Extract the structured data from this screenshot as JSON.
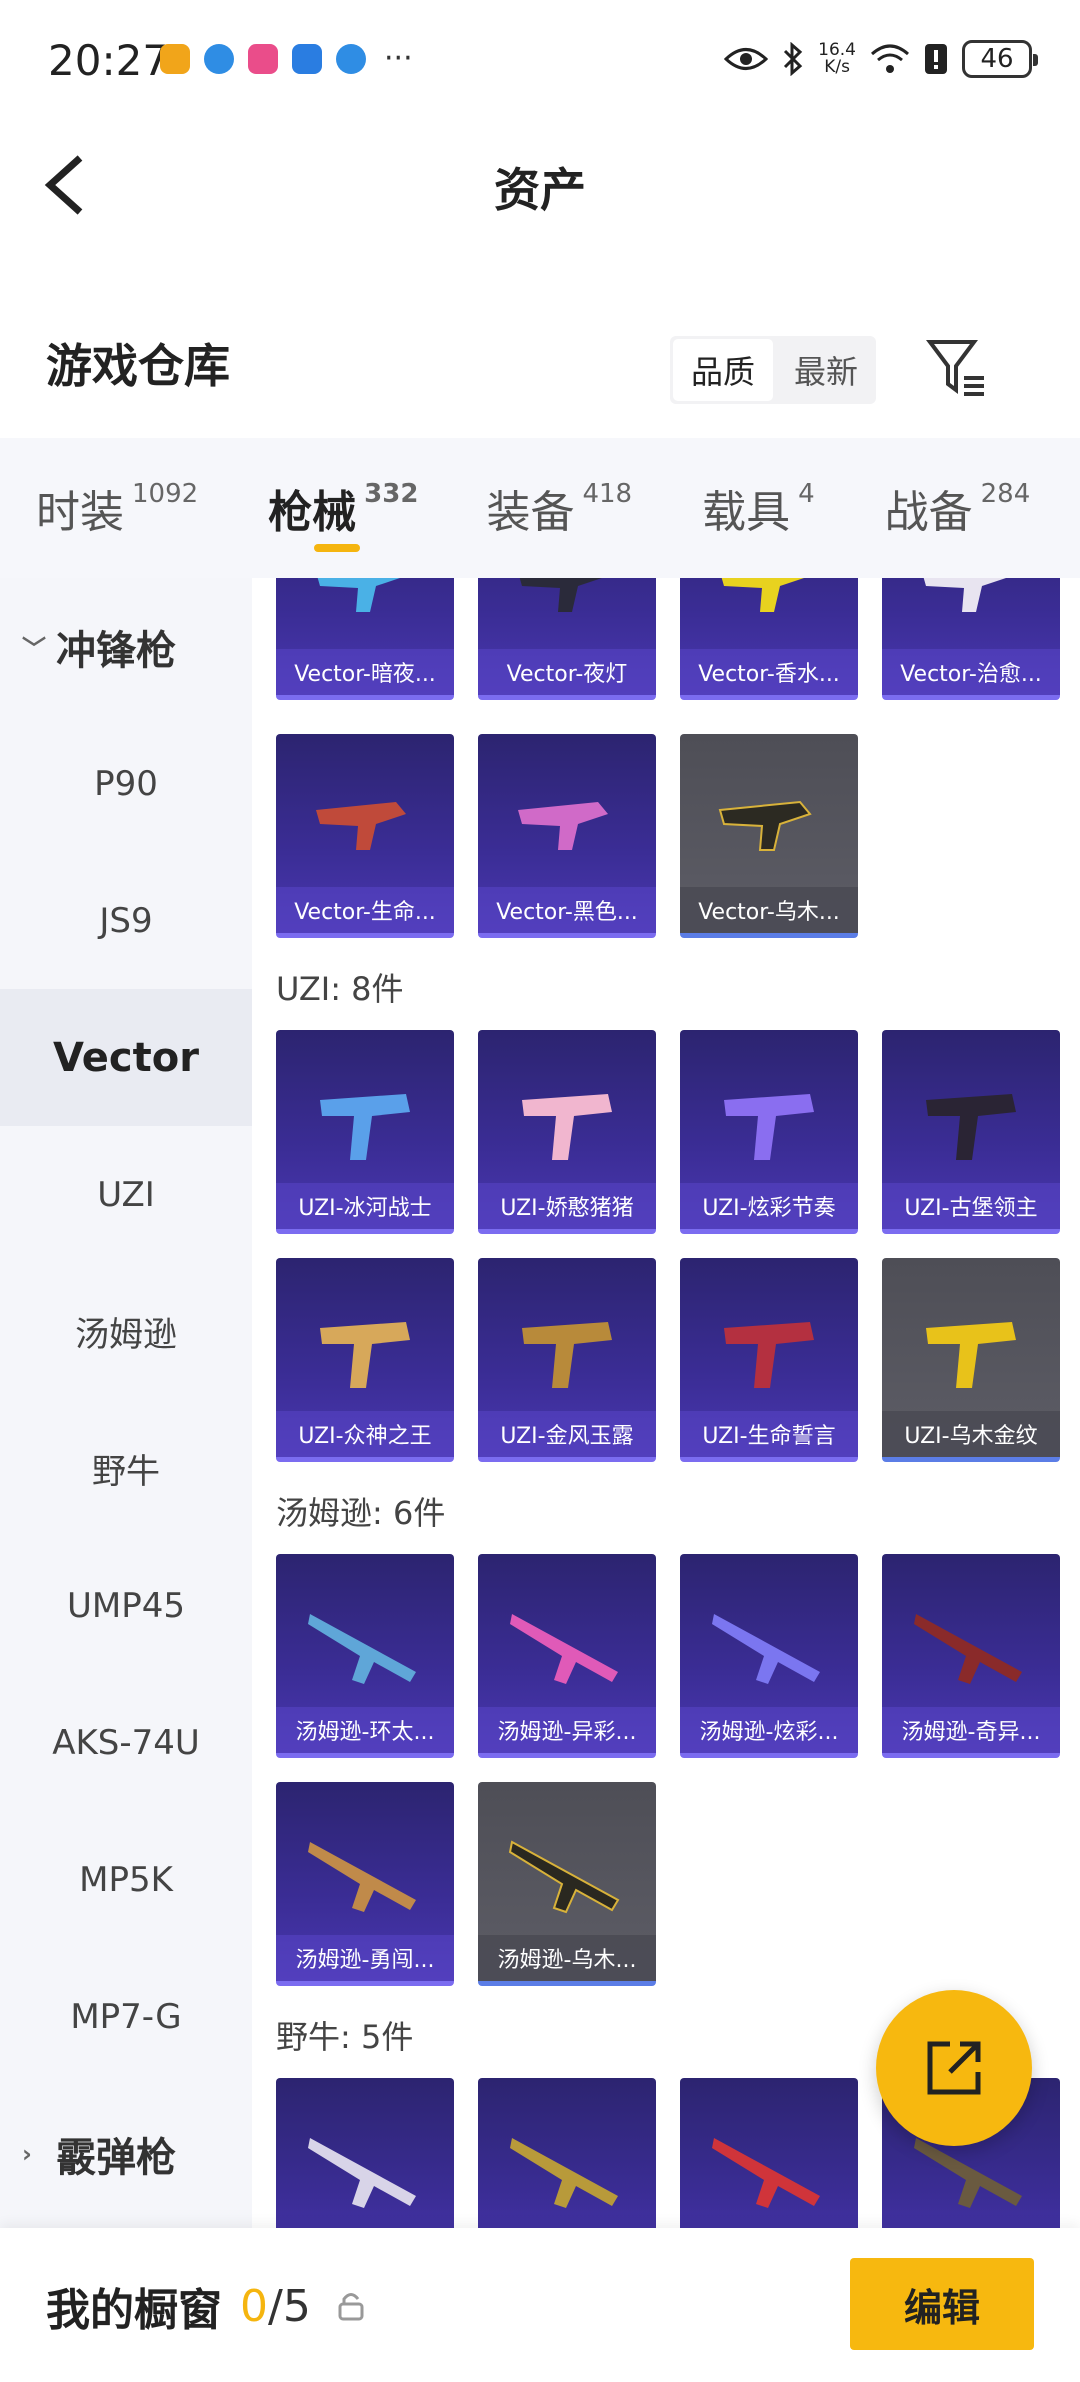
{
  "status": {
    "time": "20:27",
    "net_speed": "16.4",
    "net_unit": "K/s",
    "battery": "46",
    "more": "···"
  },
  "header": {
    "title": "资产"
  },
  "warehouse": {
    "title": "游戏仓库",
    "sort": [
      "品质",
      "最新"
    ]
  },
  "tabs": [
    {
      "label": "时装",
      "count": "1092"
    },
    {
      "label": "枪械",
      "count": "332"
    },
    {
      "label": "装备",
      "count": "418"
    },
    {
      "label": "载具",
      "count": "4"
    },
    {
      "label": "战备",
      "count": "284"
    }
  ],
  "sidebar": [
    {
      "label": "冲锋枪",
      "type": "category"
    },
    {
      "label": "P90"
    },
    {
      "label": "JS9"
    },
    {
      "label": "Vector",
      "active": true
    },
    {
      "label": "UZI"
    },
    {
      "label": "汤姆逊"
    },
    {
      "label": "野牛"
    },
    {
      "label": "UMP45"
    },
    {
      "label": "AKS-74U"
    },
    {
      "label": "MP5K"
    },
    {
      "label": "MP7-G"
    },
    {
      "label": "霰弹枪",
      "type": "category"
    }
  ],
  "vector_items": [
    "Vector-暗夜...",
    "Vector-夜灯",
    "Vector-香水...",
    "Vector-治愈...",
    "Vector-生命...",
    "Vector-黑色...",
    "Vector-乌木..."
  ],
  "uzi_title": "UZI: 8件",
  "uzi_items": [
    "UZI-冰河战士",
    "UZI-娇憨猪猪",
    "UZI-炫彩节奏",
    "UZI-古堡领主",
    "UZI-众神之王",
    "UZI-金风玉露",
    "UZI-生命誓言",
    "UZI-乌木金纹"
  ],
  "thompson_title": "汤姆逊: 6件",
  "thompson_items": [
    "汤姆逊-环太...",
    "汤姆逊-异彩...",
    "汤姆逊-炫彩...",
    "汤姆逊-奇异...",
    "汤姆逊-勇闯...",
    "汤姆逊-乌木..."
  ],
  "bison_title": "野牛: 5件",
  "bottom": {
    "label": "我的橱窗",
    "count": "0",
    "total": "/5",
    "edit": "编辑"
  }
}
